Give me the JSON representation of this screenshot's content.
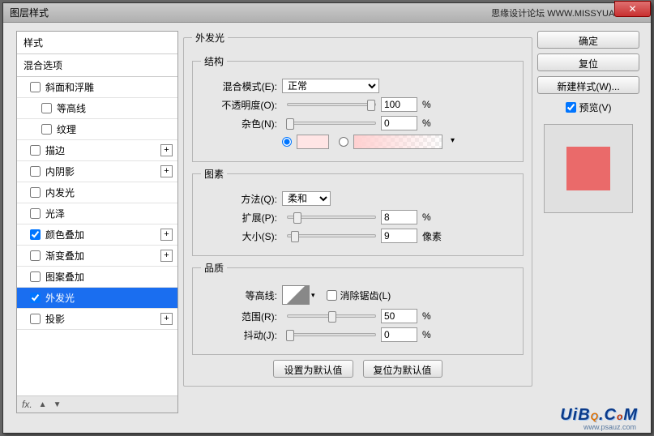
{
  "window": {
    "title": "图层样式",
    "credit": "思缘设计论坛  WWW.MISSYUAN.COM"
  },
  "left": {
    "header": "样式",
    "subheader": "混合选项",
    "items": [
      {
        "label": "斜面和浮雕",
        "checked": false,
        "plus": false,
        "indent": 0
      },
      {
        "label": "等高线",
        "checked": false,
        "plus": false,
        "indent": 1
      },
      {
        "label": "纹理",
        "checked": false,
        "plus": false,
        "indent": 1
      },
      {
        "label": "描边",
        "checked": false,
        "plus": true,
        "indent": 0
      },
      {
        "label": "内阴影",
        "checked": false,
        "plus": true,
        "indent": 0
      },
      {
        "label": "内发光",
        "checked": false,
        "plus": false,
        "indent": 0
      },
      {
        "label": "光泽",
        "checked": false,
        "plus": false,
        "indent": 0
      },
      {
        "label": "颜色叠加",
        "checked": true,
        "plus": true,
        "indent": 0
      },
      {
        "label": "渐变叠加",
        "checked": false,
        "plus": true,
        "indent": 0
      },
      {
        "label": "图案叠加",
        "checked": false,
        "plus": false,
        "indent": 0
      },
      {
        "label": "外发光",
        "checked": true,
        "plus": false,
        "indent": 0,
        "selected": true
      },
      {
        "label": "投影",
        "checked": false,
        "plus": true,
        "indent": 0
      }
    ],
    "footer_fx": "fx."
  },
  "outer_glow": {
    "legend": "外发光",
    "structure": {
      "legend": "结构",
      "blend_mode_label": "混合模式(E):",
      "blend_mode_value": "正常",
      "opacity_label": "不透明度(O):",
      "opacity_value": "100",
      "opacity_unit": "%",
      "noise_label": "杂色(N):",
      "noise_value": "0",
      "noise_unit": "%"
    },
    "elements": {
      "legend": "图素",
      "technique_label": "方法(Q):",
      "technique_value": "柔和",
      "spread_label": "扩展(P):",
      "spread_value": "8",
      "spread_unit": "%",
      "size_label": "大小(S):",
      "size_value": "9",
      "size_unit": "像素"
    },
    "quality": {
      "legend": "品质",
      "contour_label": "等高线:",
      "antialias_label": "消除锯齿(L)",
      "range_label": "范围(R):",
      "range_value": "50",
      "range_unit": "%",
      "jitter_label": "抖动(J):",
      "jitter_value": "0",
      "jitter_unit": "%"
    },
    "buttons": {
      "default": "设置为默认值",
      "reset": "复位为默认值"
    }
  },
  "right": {
    "ok": "确定",
    "cancel": "复位",
    "new_style": "新建样式(W)...",
    "preview_label": "预览(V)"
  },
  "watermark": "UiBQ.CoM",
  "watermark_sub": "www.psauz.com"
}
